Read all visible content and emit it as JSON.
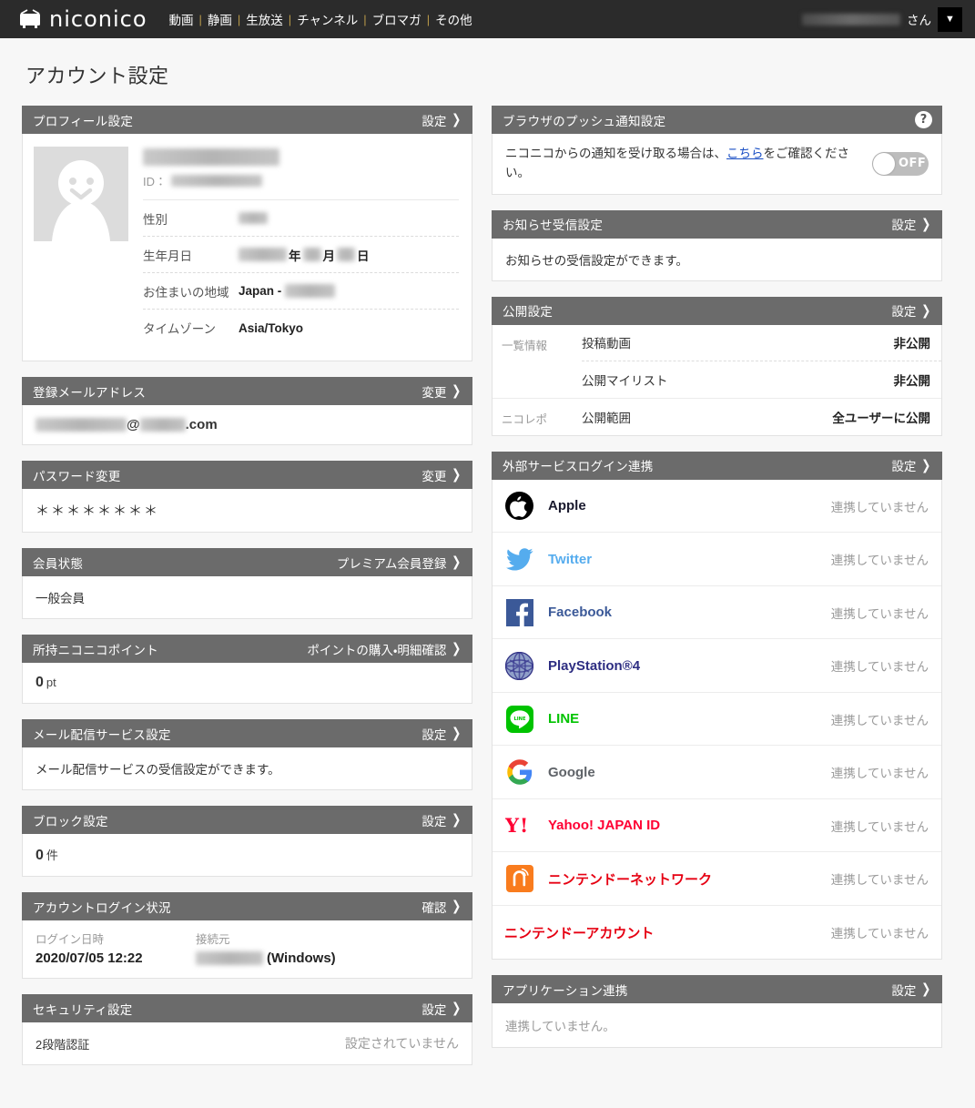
{
  "globalnav": {
    "brand": "niconico",
    "links": [
      "動画",
      "静画",
      "生放送",
      "チャンネル",
      "ブロマガ",
      "その他"
    ],
    "separator": "|",
    "user_suffix": "さん",
    "caret": "▼"
  },
  "page": {
    "title": "アカウント設定"
  },
  "profile": {
    "heading": "プロフィール設定",
    "action": "設定",
    "id_label": "ID：",
    "rows": [
      {
        "label": "性別",
        "value": ""
      },
      {
        "label": "生年月日",
        "value": "年　月　日"
      },
      {
        "label": "お住まいの地域",
        "value": "Japan -"
      },
      {
        "label": "タイムゾーン",
        "value": "Asia/Tokyo"
      }
    ],
    "birth_year_unit": "年",
    "birth_month_unit": "月",
    "birth_day_unit": "日",
    "region_prefix": "Japan -",
    "timezone": "Asia/Tokyo"
  },
  "email": {
    "heading": "登録メールアドレス",
    "action": "変更",
    "domain_suffix": ".com",
    "at": "@"
  },
  "password": {
    "heading": "パスワード変更",
    "action": "変更",
    "mask": "＊＊＊＊＊＊＊＊"
  },
  "membership": {
    "heading": "会員状態",
    "action": "プレミアム会員登録",
    "status": "一般会員"
  },
  "points": {
    "heading": "所持ニコニコポイント",
    "action": "ポイントの購入・明細確認",
    "value": "0",
    "unit": "pt"
  },
  "mail_service": {
    "heading": "メール配信サービス設定",
    "action": "設定",
    "body": "メール配信サービスの受信設定ができます。"
  },
  "block": {
    "heading": "ブロック設定",
    "action": "設定",
    "value": "0",
    "unit": "件"
  },
  "login_status": {
    "heading": "アカウントログイン状況",
    "action": "確認",
    "date_label": "ログイン日時",
    "date_value": "2020/07/05 12:22",
    "source_label": "接続元",
    "source_os": "(Windows)"
  },
  "security": {
    "heading": "セキュリティ設定",
    "action": "設定",
    "row_label": "2段階認証",
    "row_value": "設定されていません"
  },
  "push": {
    "heading": "ブラウザのプッシュ通知設定",
    "help_icon": "?",
    "text_before": "ニコニコからの通知を受け取る場合は、",
    "link_text": "こちら",
    "text_after": "をご確認ください。",
    "toggle_label": "OFF",
    "toggle_state": "off"
  },
  "notice": {
    "heading": "お知らせ受信設定",
    "action": "設定",
    "body": "お知らせの受信設定ができます。"
  },
  "public": {
    "heading": "公開設定",
    "action": "設定",
    "groups": [
      {
        "category": "一覧情報",
        "rows": [
          {
            "key": "投稿動画",
            "value": "非公開"
          },
          {
            "key": "公開マイリスト",
            "value": "非公開"
          }
        ]
      },
      {
        "category": "ニコレポ",
        "rows": [
          {
            "key": "公開範囲",
            "value": "全ユーザーに公開"
          }
        ]
      }
    ]
  },
  "external": {
    "heading": "外部サービスログイン連携",
    "action": "設定",
    "not_linked": "連携していません",
    "services": [
      {
        "icon": "apple-icon",
        "name": "Apple",
        "color": "#1a1a2e",
        "status": "連携していません"
      },
      {
        "icon": "twitter-icon",
        "name": "Twitter",
        "color": "#55acee",
        "status": "連携していません"
      },
      {
        "icon": "facebook-icon",
        "name": "Facebook",
        "color": "#3b5998",
        "status": "連携していません"
      },
      {
        "icon": "playstation-icon",
        "name": "PlayStation®4",
        "color": "#2d2d82",
        "status": "連携していません"
      },
      {
        "icon": "line-icon",
        "name": "LINE",
        "color": "#00c300",
        "status": "連携していません"
      },
      {
        "icon": "google-icon",
        "name": "Google",
        "color": "#5f6368",
        "status": "連携していません"
      },
      {
        "icon": "yahoo-icon",
        "name": "Yahoo! JAPAN ID",
        "color": "#ff0033",
        "status": "連携していません"
      },
      {
        "icon": "nintendo-network-icon",
        "name": "ニンテンドーネットワーク",
        "color": "#e60012",
        "status": "連携していません"
      },
      {
        "icon": "none",
        "name": "ニンテンドーアカウント",
        "color": "#e60012",
        "status": "連携していません"
      }
    ]
  },
  "app_link": {
    "heading": "アプリケーション連携",
    "action": "設定",
    "body": "連携していません。"
  },
  "colors": {
    "navbar": "#2b2b2b",
    "card_header": "#6b6b6b",
    "page_bg": "#f7f7f7",
    "link": "#1a4fc4"
  }
}
